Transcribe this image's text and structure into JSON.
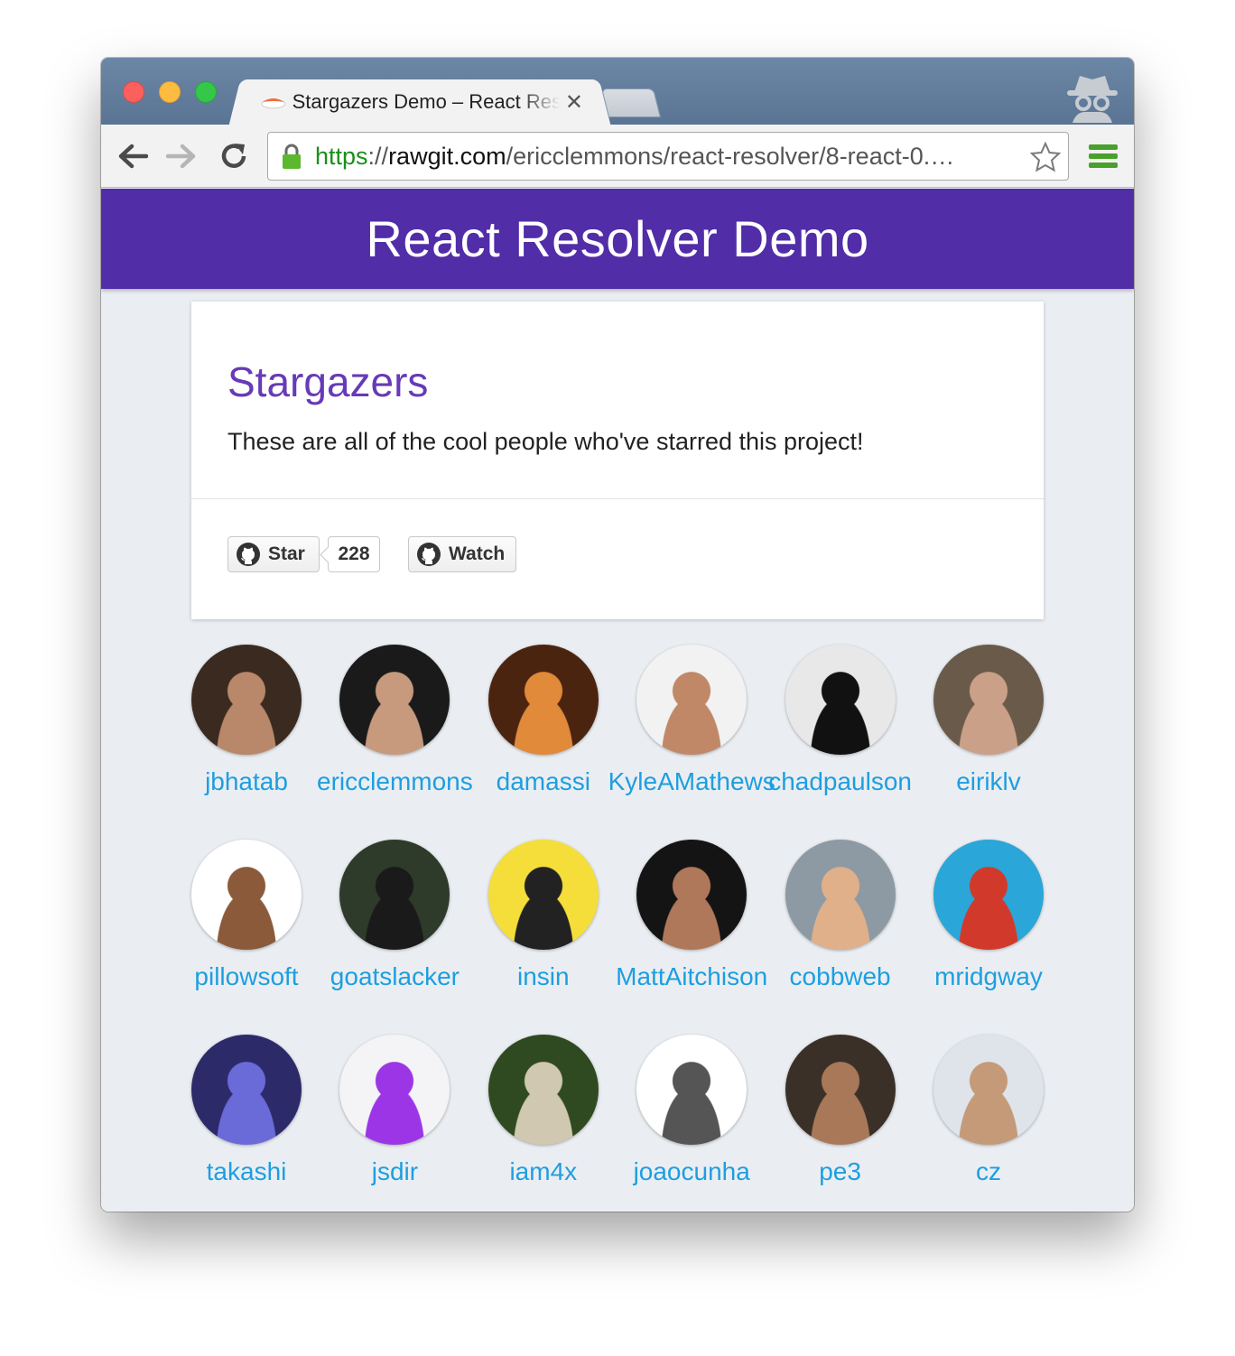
{
  "browser": {
    "tab_title": "Stargazers Demo – React Resolver",
    "tab_close": "✕",
    "url_scheme": "https",
    "url_sep": "://",
    "url_host": "rawgit.com",
    "url_path": "/ericclemmons/react-resolver/8-react-0.…"
  },
  "app": {
    "title": "React Resolver Demo"
  },
  "card": {
    "title": "Stargazers",
    "text": "These are all of the cool people who've starred this project!",
    "star_label": "Star",
    "star_count": "228",
    "watch_label": "Watch"
  },
  "stargazers": [
    {
      "login": "jbhatab",
      "color_a": "#3a2a20",
      "color_b": "#b9876a"
    },
    {
      "login": "ericclemmons",
      "color_a": "#1a1a1a",
      "color_b": "#c79a7e"
    },
    {
      "login": "damassi",
      "color_a": "#4b2410",
      "color_b": "#e08a3a"
    },
    {
      "login": "KyleAMathews",
      "color_a": "#f2f2f2",
      "color_b": "#c08866"
    },
    {
      "login": "chadpaulson",
      "color_a": "#e8e8e8",
      "color_b": "#111111"
    },
    {
      "login": "eiriklv",
      "color_a": "#6a5a4a",
      "color_b": "#caa088"
    },
    {
      "login": "pillowsoft",
      "color_a": "#ffffff",
      "color_b": "#8a5a3a"
    },
    {
      "login": "goatslacker",
      "color_a": "#2e3a2a",
      "color_b": "#1a1a1a"
    },
    {
      "login": "insin",
      "color_a": "#f5de3a",
      "color_b": "#222222"
    },
    {
      "login": "MattAitchison",
      "color_a": "#141414",
      "color_b": "#b0785a"
    },
    {
      "login": "cobbweb",
      "color_a": "#8d9aa3",
      "color_b": "#e0b08a"
    },
    {
      "login": "mridgway",
      "color_a": "#2aa6d8",
      "color_b": "#d13a2a"
    },
    {
      "login": "takashi",
      "color_a": "#2d2a6a",
      "color_b": "#6a6ad8"
    },
    {
      "login": "jsdir",
      "color_a": "#f4f4f6",
      "color_b": "#9b35e6"
    },
    {
      "login": "iam4x",
      "color_a": "#2f4a20",
      "color_b": "#d0c8b0"
    },
    {
      "login": "joaocunha",
      "color_a": "#ffffff",
      "color_b": "#555555"
    },
    {
      "login": "pe3",
      "color_a": "#3a3028",
      "color_b": "#a87858"
    },
    {
      "login": "cz",
      "color_a": "#dfe4ea",
      "color_b": "#c49a78"
    }
  ]
}
